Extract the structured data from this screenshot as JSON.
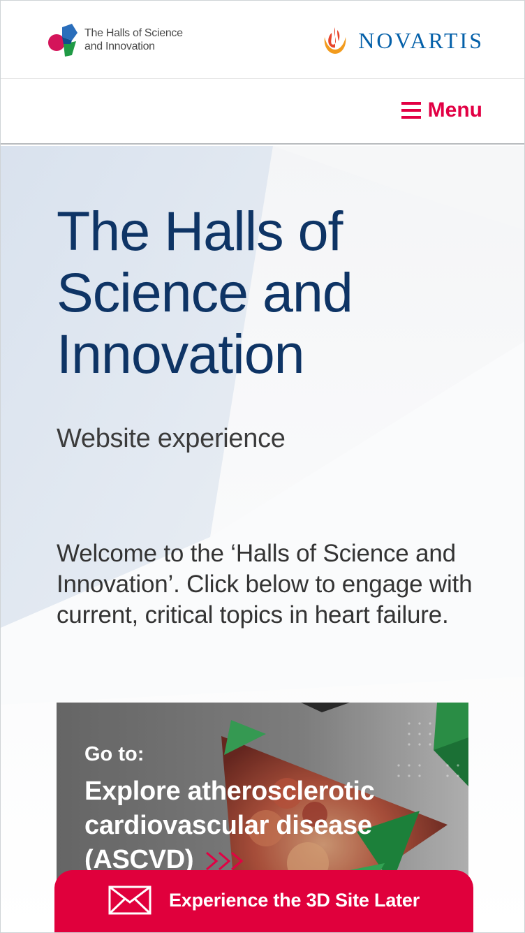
{
  "header": {
    "halls_logo_text": "The Halls of Science and Innovation",
    "novartis_brand": "NOVARTIS"
  },
  "menu": {
    "label": "Menu",
    "icon": "hamburger-icon"
  },
  "hero": {
    "title": "The Halls of Science and Innovation",
    "subtitle": "Website experience",
    "welcome": "Welcome to the ‘Halls of Science and Innovation’. Click below to engage with current, critical topics in heart failure."
  },
  "card": {
    "goto_label": "Go to:",
    "title": "Explore atherosclerotic cardiovascular disease (ASCVD)",
    "arrow_icon": "triple-chevron-right-icon"
  },
  "cta": {
    "label": "Experience the 3D Site Later",
    "icon": "envelope-icon"
  },
  "colors": {
    "brand_red": "#e20044",
    "cta_red": "#e0003c",
    "title_navy": "#0e3465",
    "novartis_blue": "#0460a9"
  }
}
